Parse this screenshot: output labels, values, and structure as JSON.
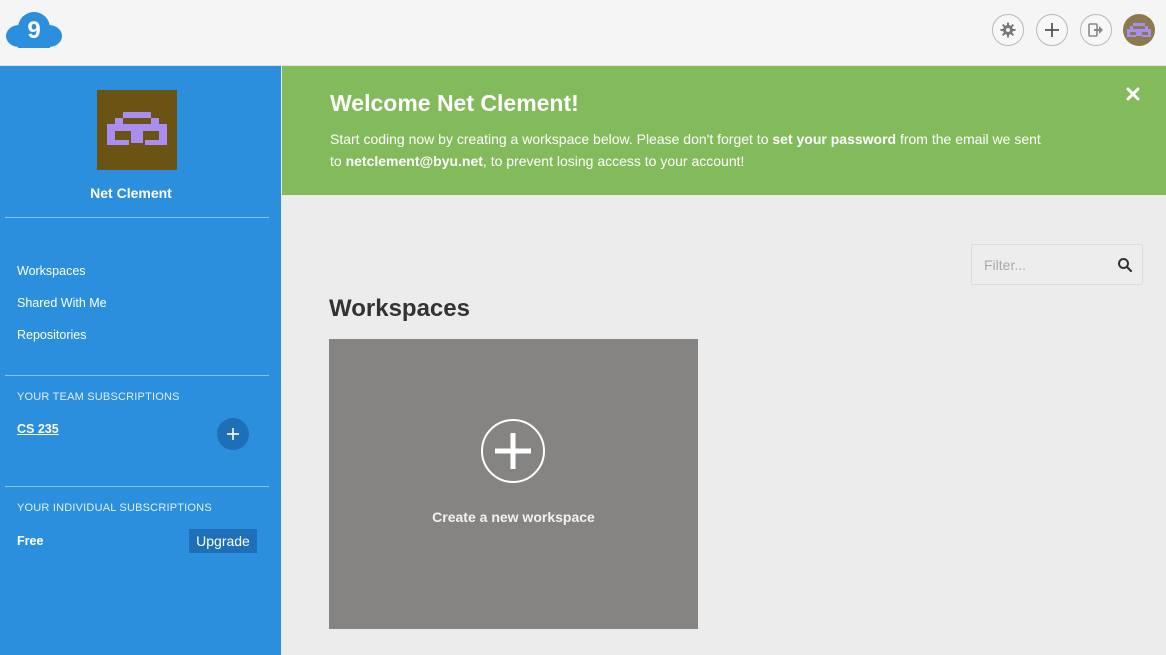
{
  "topbar": {
    "logo_text": "9",
    "settings_icon": "gear-icon",
    "add_icon": "plus-icon",
    "logout_icon": "logout-icon",
    "avatar_icon": "user-avatar-icon"
  },
  "sidebar": {
    "user_name": "Net Clement",
    "nav": [
      {
        "label": "Workspaces"
      },
      {
        "label": "Shared With Me"
      },
      {
        "label": "Repositories"
      }
    ],
    "team_subscriptions_title": "YOUR TEAM SUBSCRIPTIONS",
    "team_subscriptions": [
      {
        "label": "CS 235"
      }
    ],
    "individual_subscriptions_title": "YOUR INDIVIDUAL SUBSCRIPTIONS",
    "plan": "Free",
    "upgrade_label": "Upgrade"
  },
  "banner": {
    "title": "Welcome Net Clement!",
    "text_1": "Start coding now by creating a workspace below. Please don't forget to ",
    "text_bold_1": "set your password",
    "text_2": " from the email we sent to ",
    "text_bold_2": "netclement@byu.net",
    "text_3": ", to prevent losing access to your account!"
  },
  "main": {
    "filter_placeholder": "Filter...",
    "section_title": "Workspaces",
    "create_label": "Create a new workspace"
  },
  "colors": {
    "sidebar": "#2b8fdd",
    "banner": "#83bb5c",
    "card": "#858482",
    "accent": "#1e6fb8"
  }
}
